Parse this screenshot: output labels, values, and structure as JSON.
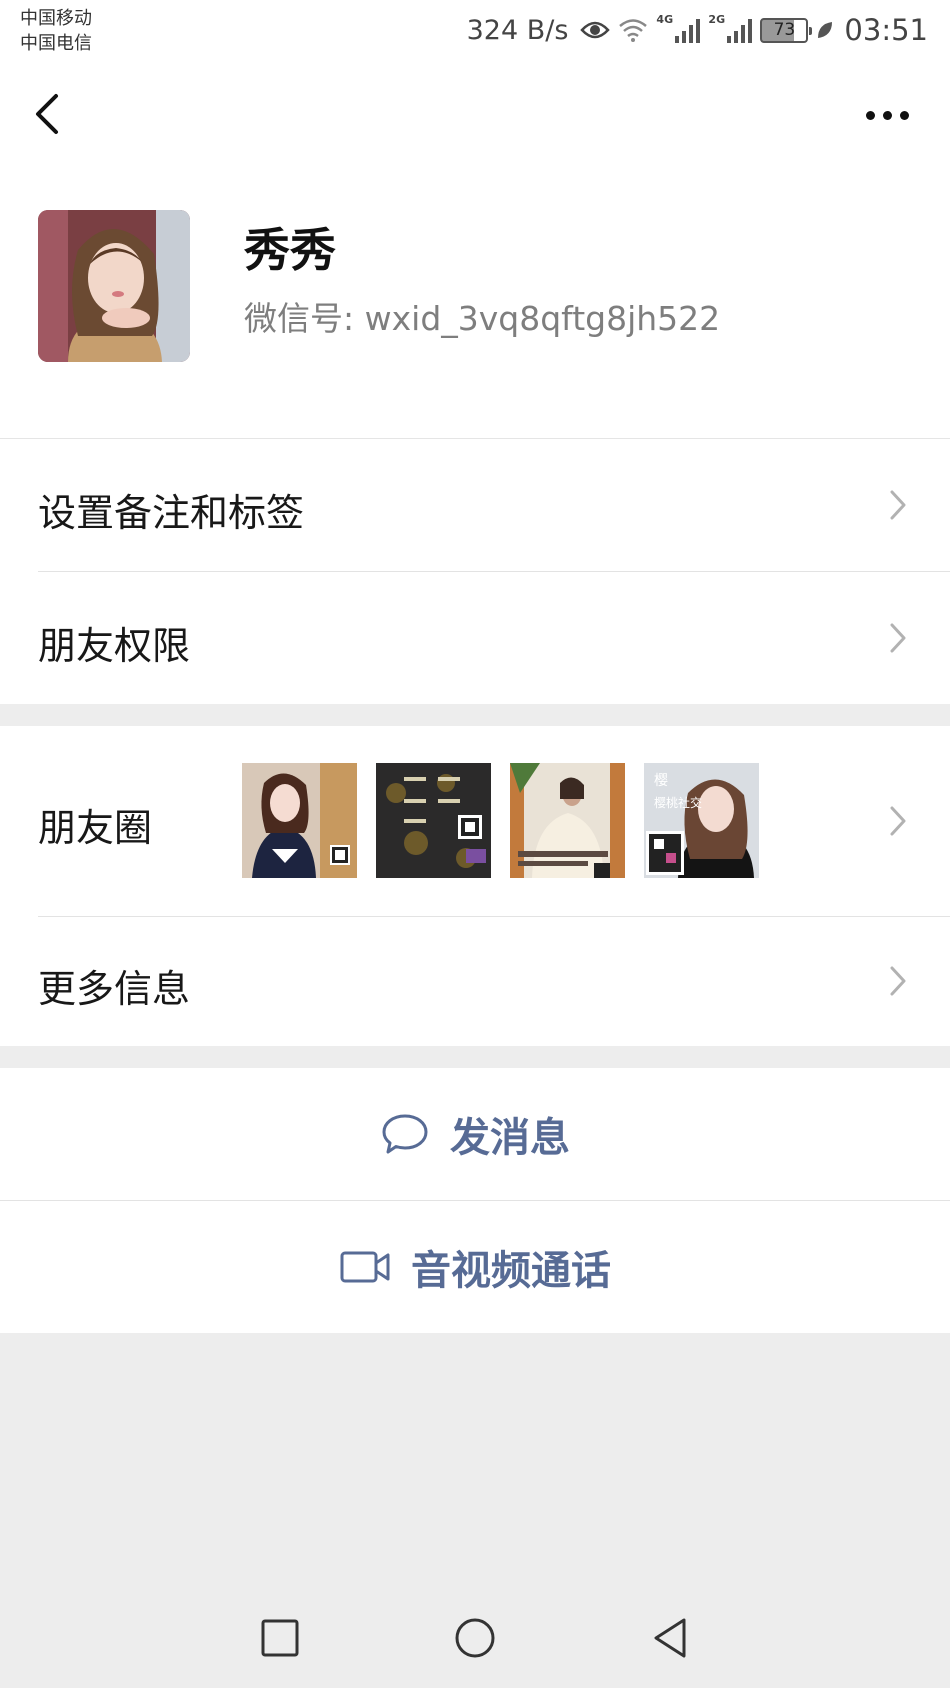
{
  "status_bar": {
    "carrier_1": "中国移动",
    "carrier_2": "中国电信",
    "net_speed": "324 B/s",
    "sim1_network": "4G",
    "sim2_network": "2G",
    "battery": "73",
    "time": "03:51"
  },
  "profile": {
    "nickname": "秀秀",
    "wechat_id_label": "微信号:",
    "wechat_id": "wxid_3vq8qftg8jh522"
  },
  "menu": {
    "set_remark": "设置备注和标签",
    "friend_permissions": "朋友权限",
    "moments": "朋友圈",
    "more_info": "更多信息"
  },
  "actions": {
    "send_message": "发消息",
    "video_call": "音视频通话"
  },
  "moments_thumbs": [
    {
      "caption": "",
      "qr": true
    },
    {
      "caption": "",
      "qr": true
    },
    {
      "caption": "",
      "qr": true
    },
    {
      "caption": "樱桃社交",
      "qr": true
    }
  ],
  "colors": {
    "link_blue": "#576b95",
    "page_bg": "#ededed",
    "text_primary": "#181818",
    "text_secondary": "#7e7e7e"
  },
  "icons": {
    "back": "chevron-left-icon",
    "more": "more-dots-icon",
    "chevron": "chevron-right-icon",
    "message": "chat-bubble-icon",
    "video": "video-camera-icon"
  }
}
